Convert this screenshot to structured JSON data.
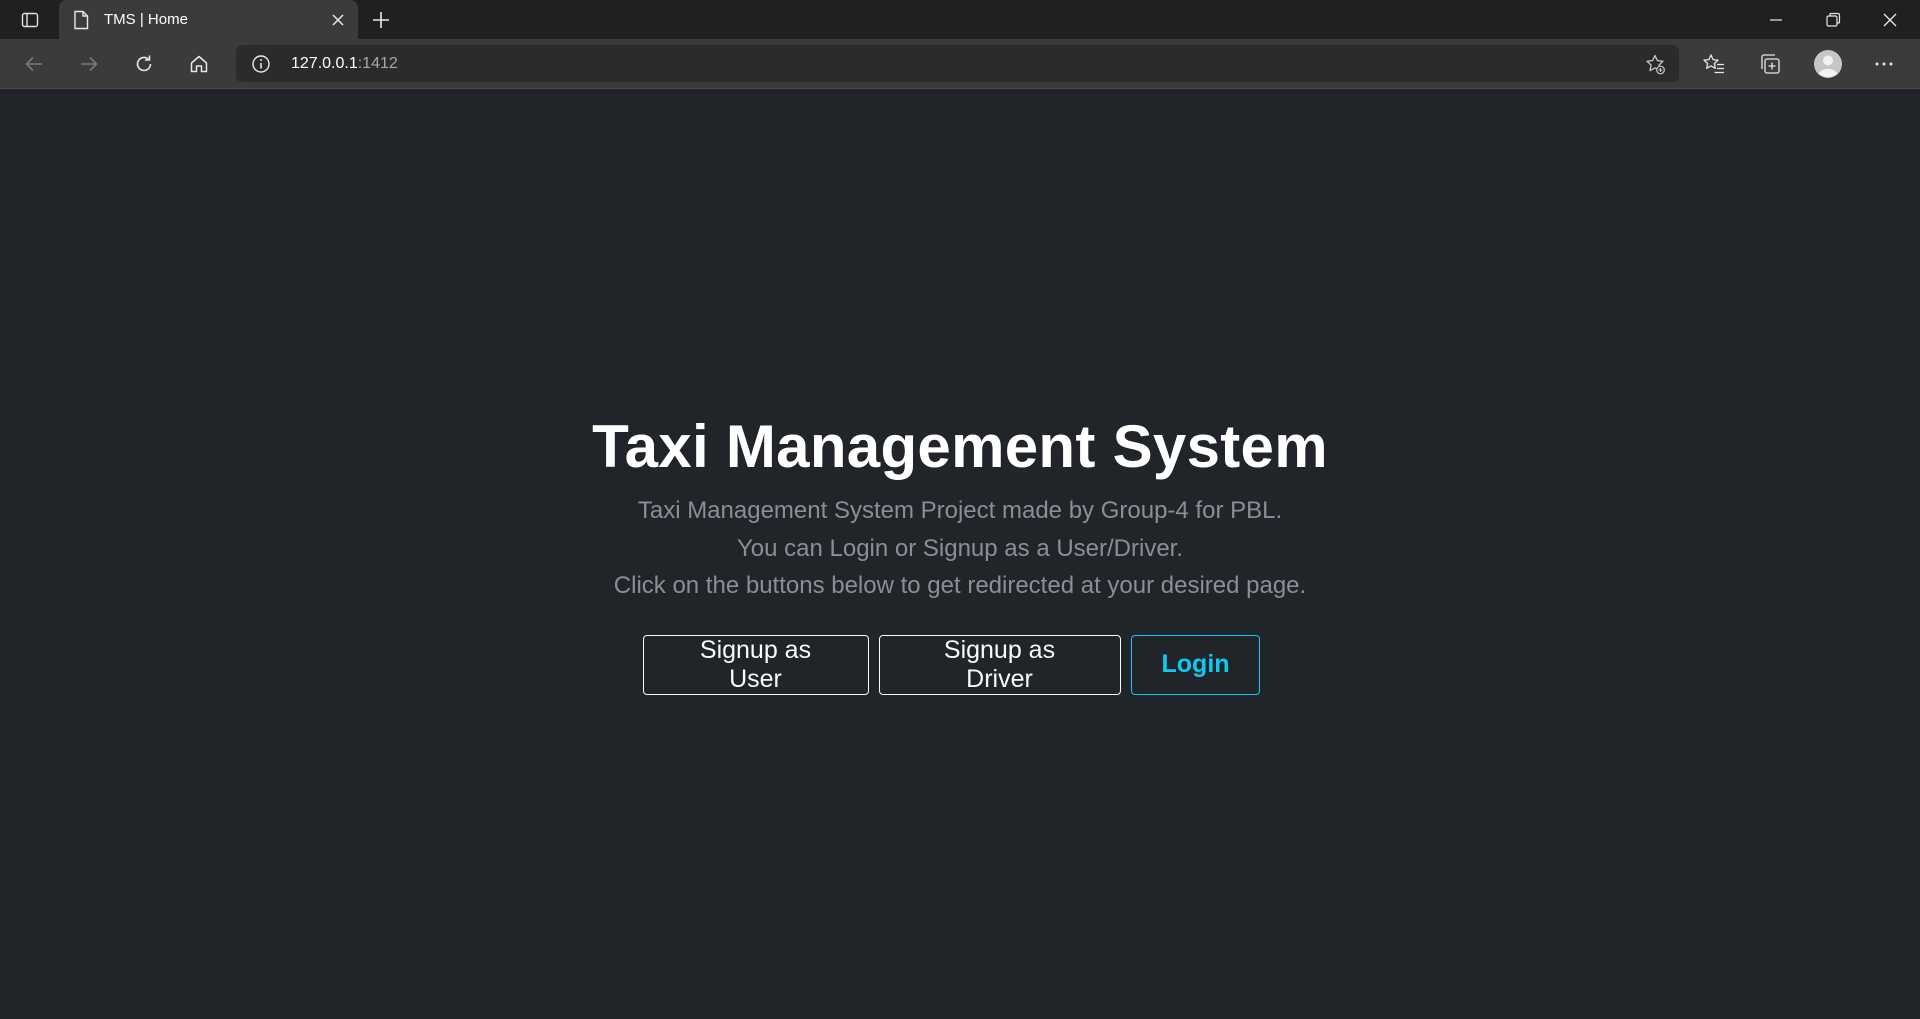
{
  "browser": {
    "tab_title": "TMS | Home",
    "url_host": "127.0.0.1",
    "url_port": ":1412"
  },
  "hero": {
    "title": "Taxi Management System",
    "lines": [
      "Taxi Management System Project made by Group-4 for PBL.",
      "You can Login or Signup as a User/Driver.",
      "Click on the buttons below to get redirected at your desired page."
    ]
  },
  "buttons": {
    "signup_user": "Signup as User",
    "signup_driver": "Signup as Driver",
    "login": "Login"
  },
  "colors": {
    "page_bg": "#212529",
    "accent_info": "#0dcaf0",
    "muted_text": "#8a8f96"
  },
  "icons": [
    "tab-actions-icon",
    "page-icon",
    "close-icon",
    "plus-icon",
    "minimize-icon",
    "restore-icon",
    "window-close-icon",
    "back-arrow-icon",
    "forward-arrow-icon",
    "reload-icon",
    "home-icon",
    "info-icon",
    "add-favorite-icon",
    "favorites-icon",
    "collections-icon",
    "profile-avatar-icon",
    "more-icon"
  ]
}
